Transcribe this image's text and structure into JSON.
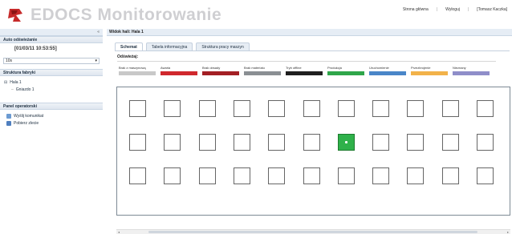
{
  "header": {
    "app_title": "EDOCS Monitorowanie",
    "links": [
      "Strona główna",
      "Wyloguj",
      "[Tomasz Kaczka]"
    ]
  },
  "left_panel": {
    "collapse_icon": "double-chevron-left-icon",
    "refresh_section": "Auto odświeżanie",
    "datetime": "[01/03/11 10:53:55]",
    "interval_value": "10s",
    "factory_section": "Struktura fabryki",
    "factory_items": [
      "Hala 1",
      "Gniazdo 1"
    ],
    "operator_section": "Panel operatorski",
    "operator_items": [
      "Wyślij komunikat",
      "Pobierz zlecie"
    ]
  },
  "main": {
    "breadcrumb": "Widok hali: Hala 1",
    "tabs": [
      "Schemat",
      "Tabela informacyjna",
      "Struktura pracy maszyn"
    ],
    "legend_title": "Odświeżaj:",
    "legend": [
      {
        "label": "Brak z maszynową",
        "color": "#c8c8c8"
      },
      {
        "label": "Awaria",
        "color": "#d0282d"
      },
      {
        "label": "Brak obsady",
        "color": "#a31f24"
      },
      {
        "label": "Brak materiału",
        "color": "#8a8f93"
      },
      {
        "label": "Tryb offline",
        "color": "#1f1f1f"
      },
      {
        "label": "Produkcja",
        "color": "#2fa64a"
      },
      {
        "label": "Uruchomienie",
        "color": "#4a86c8"
      },
      {
        "label": "Przezbrojenie",
        "color": "#f2b24a"
      },
      {
        "label": "Nieznany",
        "color": "#8f8ec9"
      }
    ],
    "machine_grid": {
      "rows": 3,
      "cols": 11,
      "active": [
        {
          "row": 1,
          "col": 6
        }
      ]
    }
  }
}
